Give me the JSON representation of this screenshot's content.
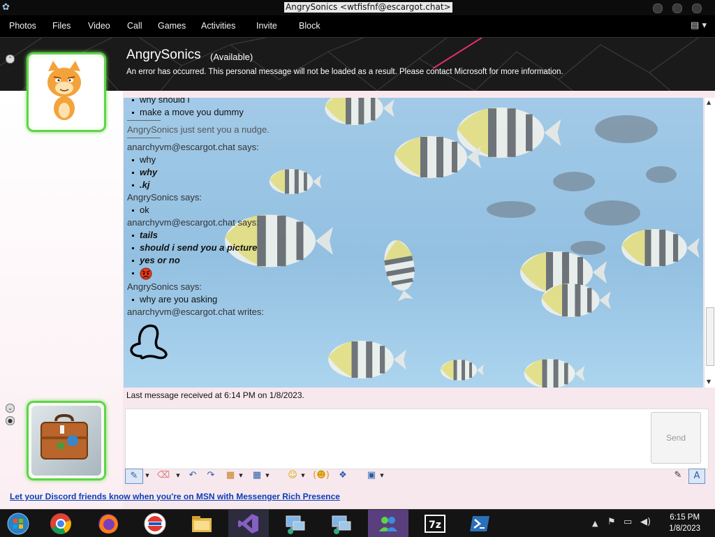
{
  "window": {
    "title": "AngrySonics <wtfisfnf@escargot.chat>"
  },
  "menu": {
    "items": [
      "Photos",
      "Files",
      "Video",
      "Call",
      "Games",
      "Activities",
      "Invite",
      "Block"
    ]
  },
  "contact": {
    "name": "AngrySonics",
    "status": "(Available)",
    "personal_message": "An error has occurred. This personal message will not be loaded as a result. Please contact Microsoft for more information."
  },
  "transcript": [
    {
      "kind": "msg",
      "text": "why should i"
    },
    {
      "kind": "msg",
      "text": "make a move you dummy"
    },
    {
      "kind": "sep"
    },
    {
      "kind": "nudge",
      "text": "AngrySonics just sent you a nudge."
    },
    {
      "kind": "sep"
    },
    {
      "kind": "sender",
      "text": "anarchyvm@escargot.chat says:"
    },
    {
      "kind": "msg",
      "text": "why"
    },
    {
      "kind": "msg-bi",
      "text": "why"
    },
    {
      "kind": "msg-bi",
      "text": ".kj"
    },
    {
      "kind": "sender",
      "text": "AngrySonics says:"
    },
    {
      "kind": "msg",
      "text": "ok"
    },
    {
      "kind": "sender",
      "text": "anarchyvm@escargot.chat says:"
    },
    {
      "kind": "msg-bi",
      "text": "tails"
    },
    {
      "kind": "msg-bi",
      "text": "should i send you a picture"
    },
    {
      "kind": "msg-bi",
      "text": "yes or no"
    },
    {
      "kind": "emoticon",
      "icon": "angry-face-icon"
    },
    {
      "kind": "sender",
      "text": "AngrySonics says:"
    },
    {
      "kind": "msg",
      "text": "why are you asking"
    },
    {
      "kind": "sender",
      "text": "anarchyvm@escargot.chat writes:"
    },
    {
      "kind": "ink",
      "icon": "handwritten-ink-drawing"
    }
  ],
  "chat": {
    "last_message": "Last message received at 6:14 PM on 1/8/2023.",
    "input_value": "",
    "send_label": "Send"
  },
  "promo": {
    "text": "Let your Discord friends know when you're on MSN with Messenger Rich Presence"
  },
  "taskbar": {
    "apps": [
      "windows-start-icon",
      "chrome-icon",
      "firefox-icon",
      "msn-icon",
      "file-explorer-icon",
      "visual-studio-icon",
      "network-computer-icon",
      "network-computer-icon",
      "messenger-contacts-icon",
      "7zip-icon",
      "powershell-icon"
    ],
    "time": "6:15 PM",
    "date": "1/8/2023"
  },
  "colors": {
    "accent_green": "#5fd44a",
    "link_blue": "#0b3db8",
    "header_bg": "#1a1a1a"
  }
}
